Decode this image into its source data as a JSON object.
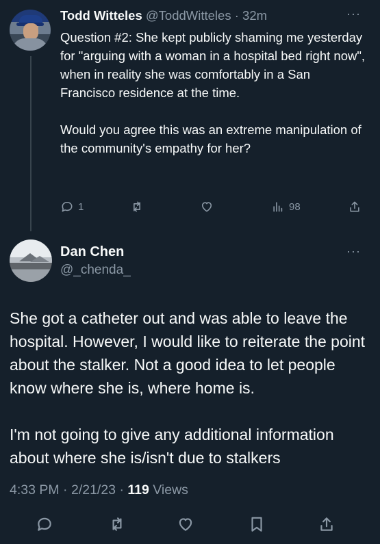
{
  "reply_context": {
    "author": {
      "name": "Todd Witteles",
      "handle": "@ToddWitteles",
      "separator": "·",
      "time": "32m"
    },
    "paragraphs": [
      "Question #2: She kept publicly shaming me yesterday for \"arguing with a woman in a hospital bed right now\", when in reality she was comfortably in a San Francisco residence at the time.",
      "Would you agree this was an extreme manipulation of the community's empathy for her?"
    ],
    "actions": {
      "reply_count": "1",
      "retweet_count": "",
      "like_count": "",
      "views_count": "98"
    },
    "more_label": "···"
  },
  "main_tweet": {
    "author": {
      "name": "Dan Chen",
      "handle": "@_chenda_"
    },
    "more_label": "···",
    "paragraphs": [
      "She got a catheter out and was able to leave the hospital. However, I would like to reiterate the point about the stalker. Not a good idea to let people know where she is, where home is.",
      "I'm not going to give any additional information about where she is/isn't due to stalkers"
    ],
    "meta": {
      "time": "4:33 PM",
      "sep1": " · ",
      "date": "2/21/23",
      "sep2": " · ",
      "views_count": "119",
      "views_label": " Views"
    }
  },
  "icons": {
    "reply": "reply-icon",
    "retweet": "retweet-icon",
    "like": "heart-icon",
    "views": "views-icon",
    "share": "share-icon",
    "bookmark": "bookmark-icon"
  },
  "colors": {
    "background": "#15202b",
    "text": "#f7f9f9",
    "muted": "#8b98a5",
    "divider": "#38444d"
  }
}
